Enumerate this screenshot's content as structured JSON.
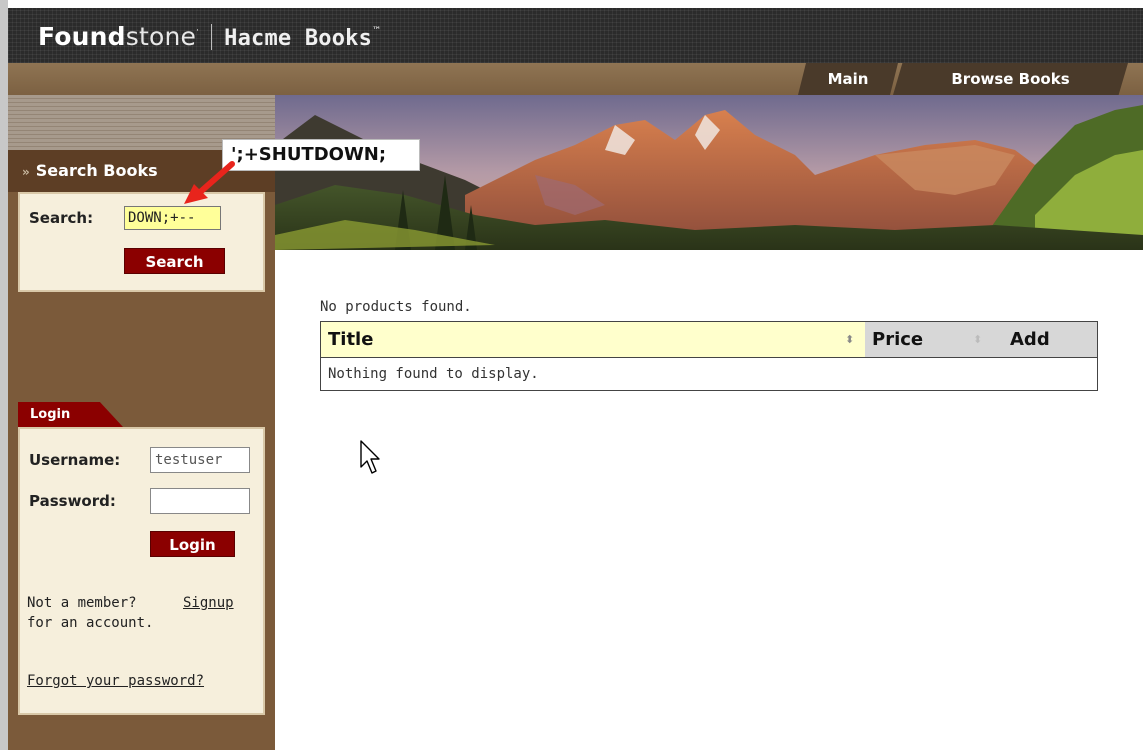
{
  "header": {
    "brand_bold": "Found",
    "brand_rest": "stone",
    "brand_mark": "·",
    "app_name": "Hacme Books",
    "app_tm": "™"
  },
  "nav": {
    "main_label": "Main",
    "browse_label": "Browse Books"
  },
  "sidebar": {
    "search_header": "Search Books",
    "search_chevron": "»",
    "search_label": "Search:",
    "search_value": "DOWN;+--",
    "search_button": "Search",
    "login_tab": "Login",
    "username_label": "Username:",
    "username_value": "testuser",
    "password_label": "Password:",
    "password_value": "",
    "login_button": "Login",
    "not_member_text": "Not a member?",
    "signup_link": "Signup",
    "for_account_text": "for an account.",
    "forgot_link": "Forgot your password?"
  },
  "callout": {
    "text": "';+SHUTDOWN;",
    "arrow_color": "#e8241c"
  },
  "content": {
    "no_products": "No products found.",
    "columns": [
      "Title",
      "Price",
      "Add"
    ],
    "empty_message": "Nothing found to display."
  },
  "colors": {
    "sidebar_brown": "#7b5a3a",
    "button_red": "#8b0000",
    "panel_cream": "#f6efdc",
    "header_yellow": "#ffffcc"
  }
}
